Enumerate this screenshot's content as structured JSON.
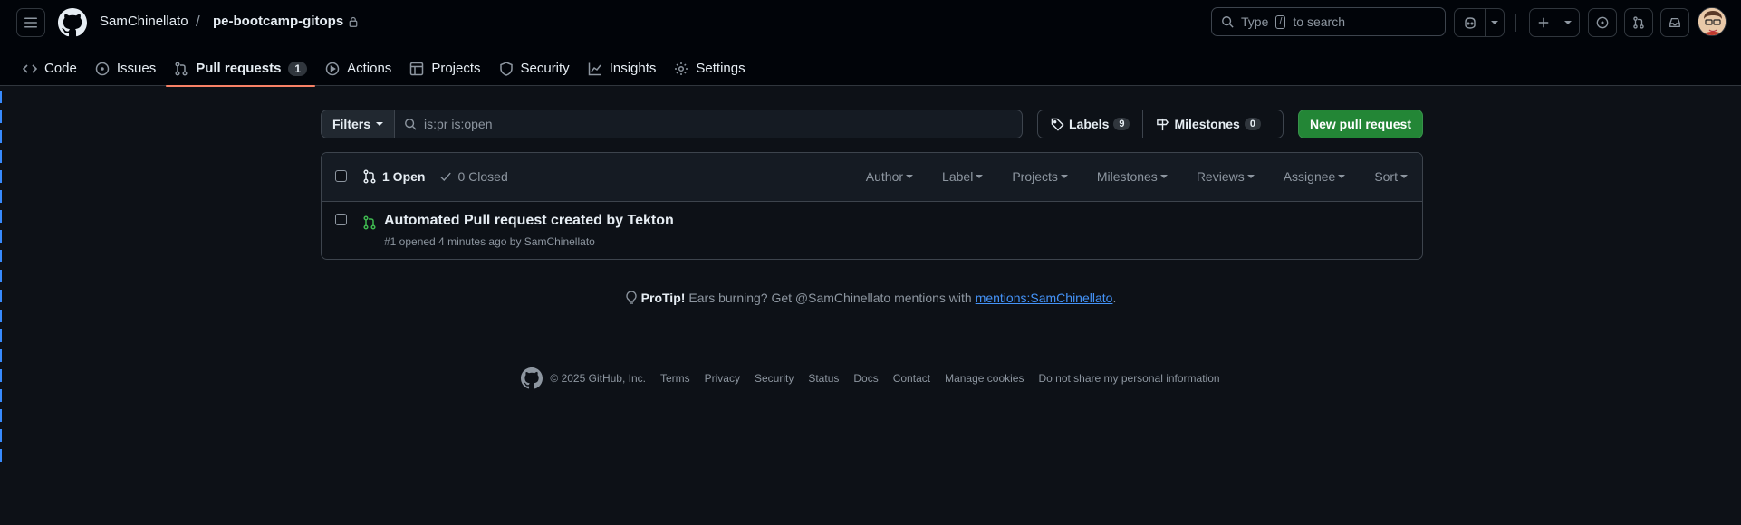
{
  "header": {
    "owner": "SamChinellato",
    "separator": "/",
    "repo": "pe-bootcamp-gitops",
    "search": {
      "prefix": "Type",
      "key": "/",
      "suffix": "to search"
    }
  },
  "tabs": [
    {
      "label": "Code",
      "icon": "code-icon"
    },
    {
      "label": "Issues",
      "icon": "issue-icon"
    },
    {
      "label": "Pull requests",
      "icon": "pull-request-icon",
      "count": "1",
      "active": true
    },
    {
      "label": "Actions",
      "icon": "play-icon"
    },
    {
      "label": "Projects",
      "icon": "table-icon"
    },
    {
      "label": "Security",
      "icon": "shield-icon"
    },
    {
      "label": "Insights",
      "icon": "graph-icon"
    },
    {
      "label": "Settings",
      "icon": "gear-icon"
    }
  ],
  "toolbar": {
    "filters_label": "Filters",
    "filter_value": "is:pr is:open",
    "labels_label": "Labels",
    "labels_count": "9",
    "milestones_label": "Milestones",
    "milestones_count": "0",
    "new_pr_label": "New pull request"
  },
  "list": {
    "open_label": "1 Open",
    "closed_label": "0 Closed",
    "filters": [
      "Author",
      "Label",
      "Projects",
      "Milestones",
      "Reviews",
      "Assignee",
      "Sort"
    ],
    "items": [
      {
        "title": "Automated Pull request created by Tekton",
        "meta": "#1 opened 4 minutes ago by SamChinellato"
      }
    ]
  },
  "protip": {
    "bold": "ProTip!",
    "text": "Ears burning? Get @SamChinellato mentions with",
    "link": "mentions:SamChinellato",
    "end": "."
  },
  "footer": {
    "copyright": "© 2025 GitHub, Inc.",
    "links": [
      "Terms",
      "Privacy",
      "Security",
      "Status",
      "Docs",
      "Contact",
      "Manage cookies",
      "Do not share my personal information"
    ]
  },
  "colors": {
    "accent": "#f78166",
    "link": "#4493f8",
    "success": "#238636",
    "open": "#3fb950",
    "background": "#0d1117"
  }
}
